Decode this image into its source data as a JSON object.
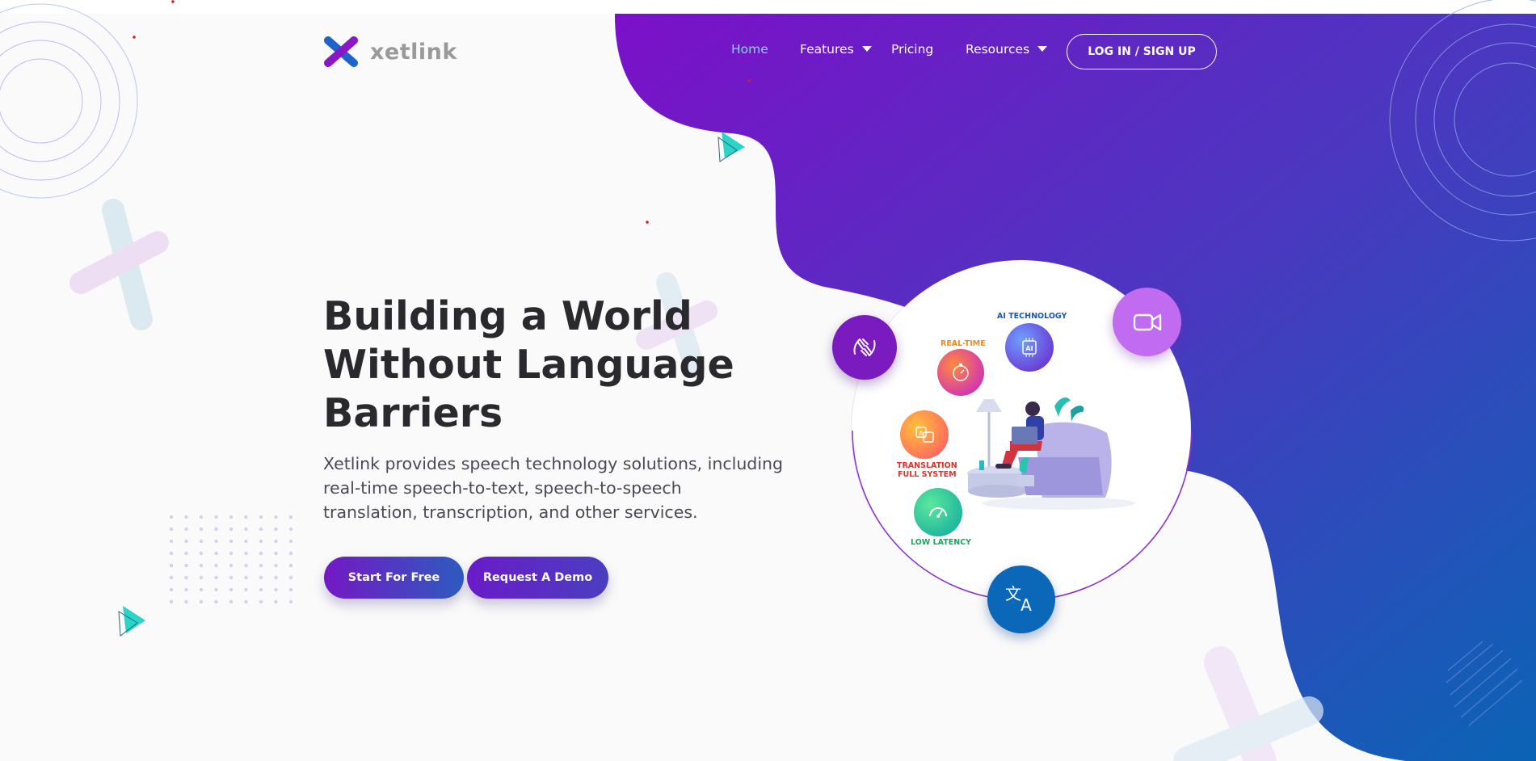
{
  "brand": {
    "name": "xetlink"
  },
  "nav": {
    "items": [
      {
        "label": "Home",
        "active": true,
        "has_dropdown": false
      },
      {
        "label": "Features",
        "active": false,
        "has_dropdown": true
      },
      {
        "label": "Pricing",
        "active": false,
        "has_dropdown": false
      },
      {
        "label": "Resources",
        "active": false,
        "has_dropdown": true
      }
    ],
    "login_label": "LOG IN / SIGN UP"
  },
  "hero": {
    "title_lines": [
      "Building a World",
      "Without Language",
      "Barriers"
    ],
    "subtitle_lines": [
      "Xetlink provides speech technology solutions, including",
      "real-time speech-to-text, speech-to-speech",
      "translation, transcription, and other services."
    ],
    "cta_primary": "Start For Free",
    "cta_secondary": "Request A Demo"
  },
  "illustration": {
    "features": [
      {
        "label": "AI TECHNOLOGY",
        "color": "#1a56b8",
        "icon": "ai-chip-icon"
      },
      {
        "label": "REAL-TIME",
        "color": "#f08a1c",
        "icon": "stopwatch-icon"
      },
      {
        "label_lines": [
          "TRANSLATION",
          "FULL SYSTEM"
        ],
        "color": "#e0312b",
        "icon": "translate-bubble-icon"
      },
      {
        "label": "LOW LATENCY",
        "color": "#1aa55a",
        "icon": "speedometer-icon"
      }
    ],
    "orbit_icons": [
      "sign-language-icon",
      "video-camera-icon",
      "translate-icon"
    ]
  },
  "colors": {
    "gradient_start": "#7a12c9",
    "gradient_end": "#0c62b6",
    "nav_active": "#8fd0ff",
    "heading": "#2a2a2e",
    "accent_teal": "#2ad4c8"
  }
}
